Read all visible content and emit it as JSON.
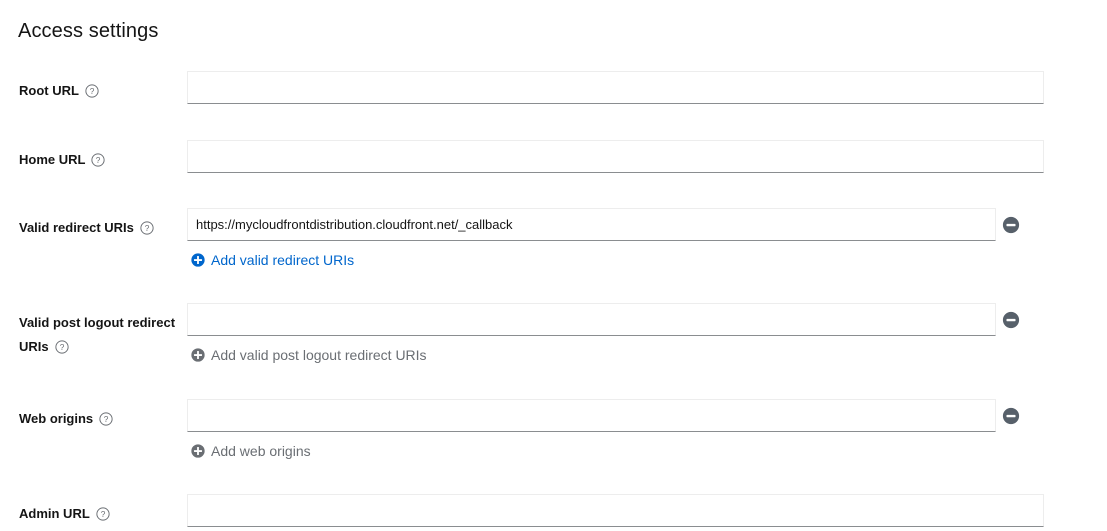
{
  "section": {
    "title": "Access settings"
  },
  "colors": {
    "link_blue": "#0066cc",
    "disabled_gray": "#6a6e73",
    "remove_icon": "#57606a",
    "text": "#151515",
    "input_border_bottom": "#8a8d90",
    "input_border": "#ededed",
    "background": "#ffffff"
  },
  "fields": [
    {
      "id": "root-url",
      "label": "Root URL",
      "help_icon": "question-circle-icon",
      "value": "",
      "placeholder": "",
      "has_remove": false,
      "add_link": null
    },
    {
      "id": "home-url",
      "label": "Home URL",
      "help_icon": "question-circle-icon",
      "value": "",
      "placeholder": "",
      "has_remove": false,
      "add_link": null
    },
    {
      "id": "valid-redirect-uris",
      "label": "Valid redirect URIs",
      "help_icon": "question-circle-icon",
      "value": "https://mycloudfrontdistribution.cloudfront.net/_callback",
      "placeholder": "",
      "has_remove": true,
      "remove_icon": "minus-circle-icon",
      "add_link": {
        "label": "Add valid redirect URIs",
        "icon": "plus-circle-icon",
        "enabled": true
      }
    },
    {
      "id": "valid-post-logout-redirect-uris",
      "label": "Valid post logout redirect URIs",
      "help_icon": "question-circle-icon",
      "value": "",
      "placeholder": "",
      "has_remove": true,
      "remove_icon": "minus-circle-icon",
      "add_link": {
        "label": "Add valid post logout redirect URIs",
        "icon": "plus-circle-icon",
        "enabled": false
      }
    },
    {
      "id": "web-origins",
      "label": "Web origins",
      "help_icon": "question-circle-icon",
      "value": "",
      "placeholder": "",
      "has_remove": true,
      "remove_icon": "minus-circle-icon",
      "add_link": {
        "label": "Add web origins",
        "icon": "plus-circle-icon",
        "enabled": false
      }
    },
    {
      "id": "admin-url",
      "label": "Admin URL",
      "help_icon": "question-circle-icon",
      "value": "",
      "placeholder": "",
      "has_remove": false,
      "add_link": null
    }
  ]
}
